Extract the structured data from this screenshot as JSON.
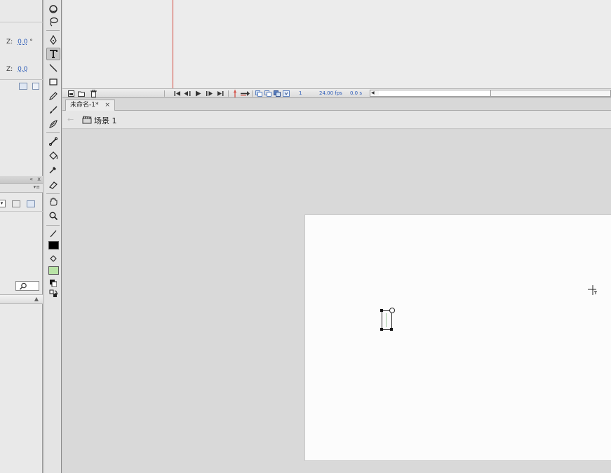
{
  "properties": {
    "rotation_z_label": "Z:",
    "rotation_z_value": "0.0",
    "rotation_z_unit": "°",
    "position_z_label": "Z:",
    "position_z_value": "0.0"
  },
  "library": {
    "header_collapse": "«",
    "header_close": "x",
    "menu_icon": "▾≡",
    "dropdown_arrow": "▾",
    "colheader_arrow": "▲"
  },
  "timeline": {
    "current_frame": "1",
    "fps": "24.00 fps",
    "elapsed": "0.0 s"
  },
  "document": {
    "tab_label": "未命名-1*",
    "tab_close": "×"
  },
  "edit_bar": {
    "back_arrow": "←",
    "scene_label": "场景 1"
  },
  "colors": {
    "playhead": "#d2443a",
    "fill_color": "#000000",
    "stroke_color": "#b9e3a6",
    "stage": "#fcfcfc",
    "pasteboard": "#d9d9d9"
  },
  "tools": [
    "3d-rotation",
    "lasso",
    "pen",
    "text",
    "line",
    "rectangle",
    "pencil",
    "brush",
    "deco",
    "bone",
    "paint-bucket",
    "eyedropper",
    "eraser",
    "hand",
    "zoom",
    "stroke-color",
    "fill-color",
    "black-white",
    "swap-colors"
  ]
}
